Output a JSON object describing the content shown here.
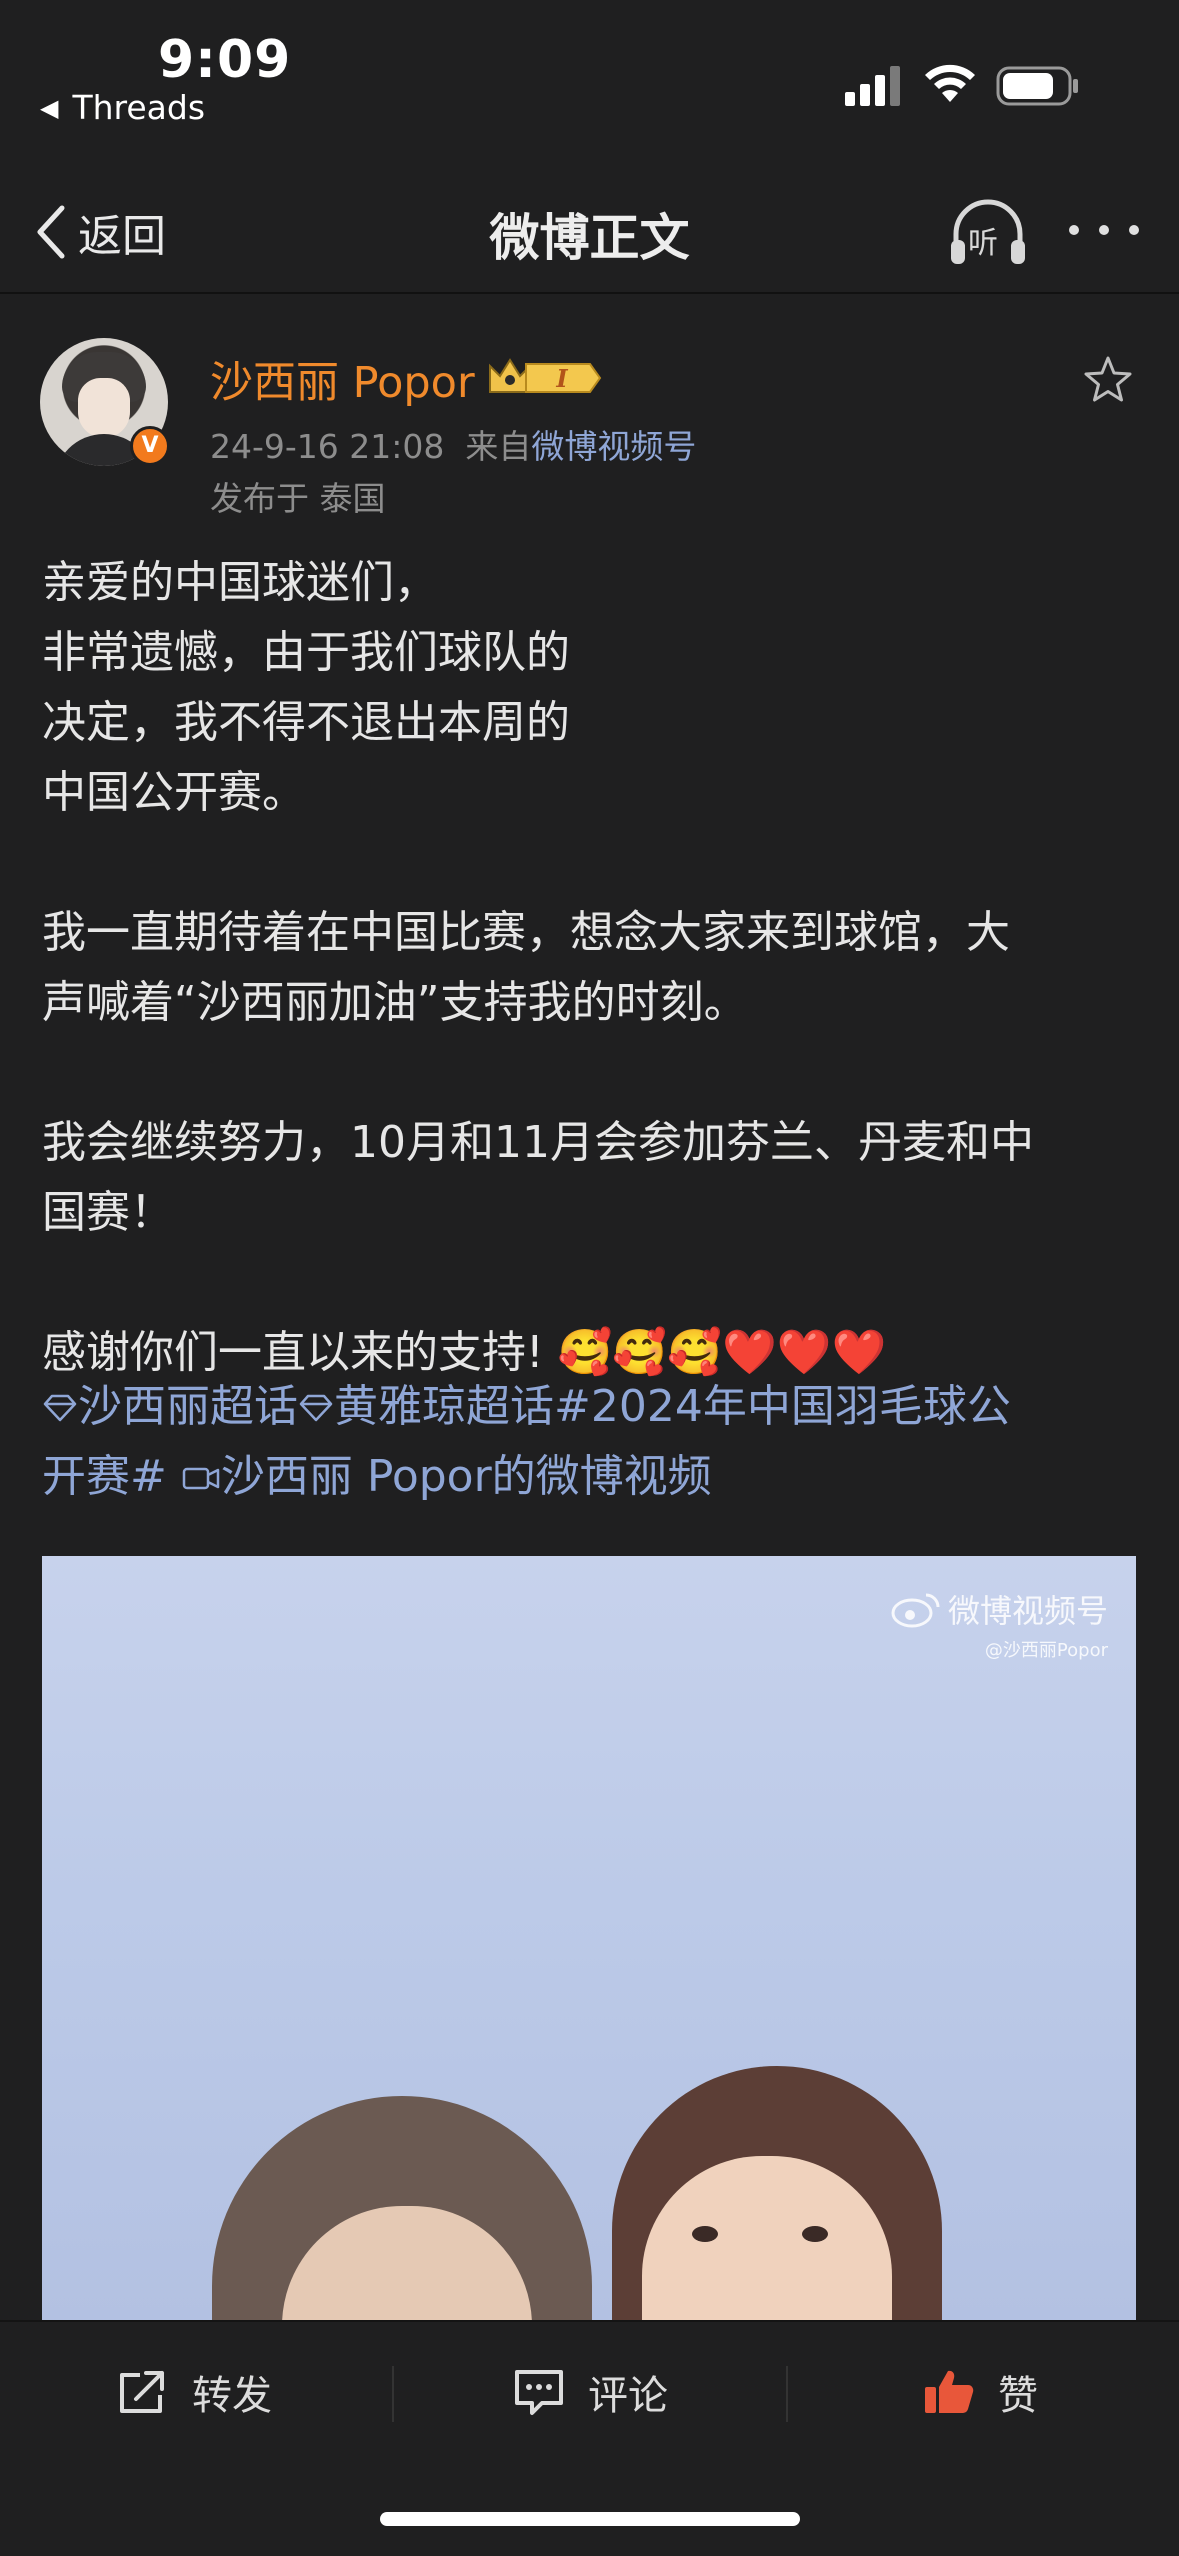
{
  "status_bar": {
    "time": "9:09",
    "back_app": "Threads",
    "back_arrow": "◀"
  },
  "nav": {
    "back_label": "返回",
    "title": "微博正文",
    "listen_label": "听"
  },
  "post": {
    "author": "沙西丽 Popor",
    "verified_mark": "V",
    "member_badge_text": "I",
    "datetime": "24-9-16 21:08",
    "source_prefix": "来自",
    "source": "微博视频号",
    "location": "发布于 泰国",
    "paragraphs": [
      [
        "亲爱的中国球迷们，",
        "非常遗憾，由于我们球队的",
        "决定，我不得不退出本周的",
        "中国公开赛。"
      ],
      [
        "我一直期待着在中国比赛，想念大家来到球馆，大",
        "声喊着“沙西丽加油”支持我的时刻。"
      ],
      [
        "我会继续努力，10月和11月会参加芬兰、丹麦和中",
        "国赛！"
      ]
    ],
    "thanks_line": "感谢你们一直以来的支持! 🥰🥰🥰❤️❤️❤️",
    "tags": {
      "supertopic1": "沙西丽超话",
      "supertopic2": "黄雅琼超话",
      "hashtag_part1": "#2024年中国羽毛球公",
      "hashtag_part2": "开赛#",
      "video_link": "沙西丽 Popor的微博视频"
    }
  },
  "video": {
    "watermark_brand": "微博视频号",
    "watermark_user": "@沙西丽Popor"
  },
  "toolbar": {
    "repost": "转发",
    "comment": "评论",
    "like": "赞"
  },
  "colors": {
    "background": "#1f1f20",
    "author_orange": "#f08a2c",
    "link_blue": "#8fa6d6",
    "meta_gray": "#8d8d8d"
  }
}
